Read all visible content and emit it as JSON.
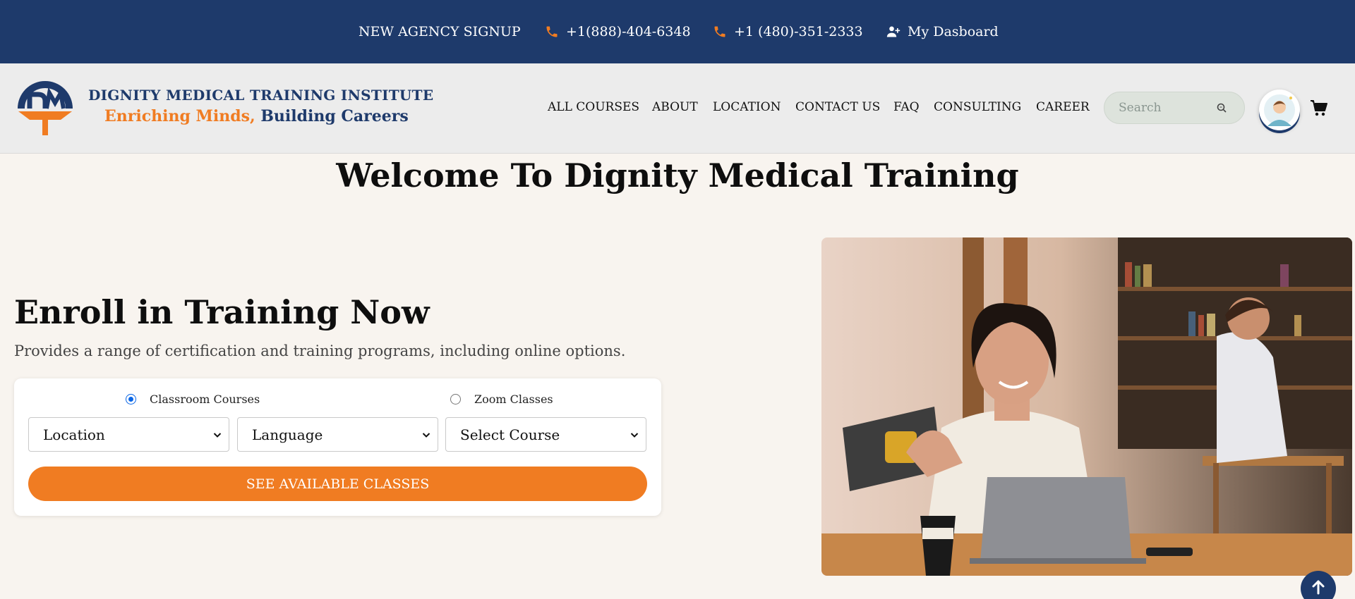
{
  "topbar": {
    "agency_signup": "NEW AGENCY SIGNUP",
    "phone_1": "+1(888)-404-6348",
    "phone_2": "+1 (480)-351-2333",
    "dashboard": "My Dasboard"
  },
  "brand": {
    "name": "DIGNITY MEDICAL TRAINING INSTITUTE",
    "tagline_part1": "Enriching Minds,",
    "tagline_part2": "Building Careers",
    "logo_letters": "DM"
  },
  "nav": {
    "items": [
      "ALL COURSES",
      "ABOUT",
      "LOCATION",
      "CONTACT US",
      "FAQ",
      "CONSULTING",
      "CAREER"
    ]
  },
  "search": {
    "placeholder": "Search"
  },
  "hero": {
    "welcome": "Welcome To Dignity Medical Training",
    "enroll_title": "Enroll in Training Now",
    "enroll_subtitle": "Provides a range of certification and training programs, including online options."
  },
  "enroll_form": {
    "radio_classroom": "Classroom Courses",
    "radio_zoom": "Zoom Classes",
    "selected_mode": "Classroom Courses",
    "select_location": "Location",
    "select_language": "Language",
    "select_course": "Select Course",
    "cta": "SEE AVAILABLE CLASSES"
  },
  "icons": {
    "phone": "phone-icon",
    "user_plus": "user-plus-icon",
    "search": "search-icon",
    "cart": "cart-icon",
    "chevron": "chevron-down-icon",
    "arrow_up": "arrow-up-icon"
  },
  "colors": {
    "navy": "#1e3a6b",
    "orange": "#f07c22",
    "background": "#f8f4ef",
    "radio_blue": "#0a66e6"
  }
}
